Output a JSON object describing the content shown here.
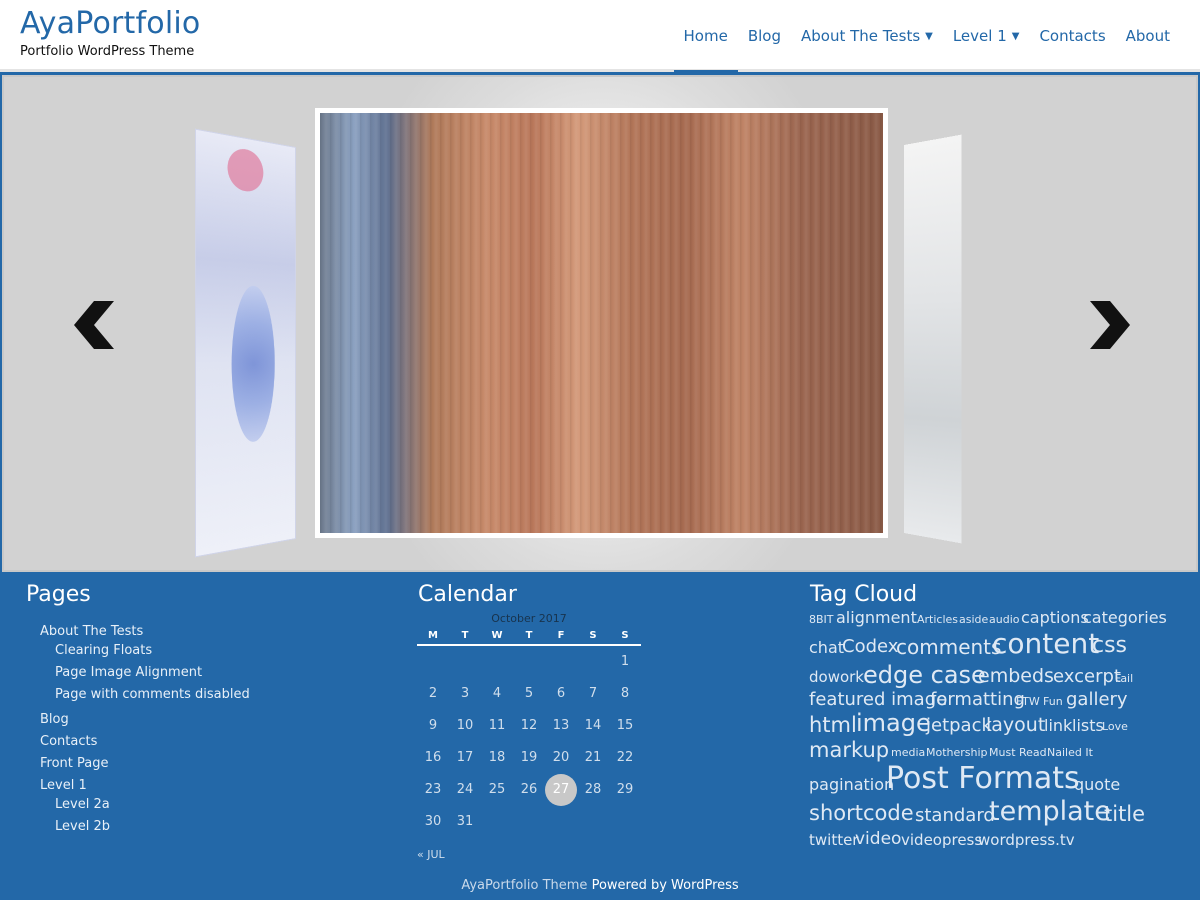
{
  "site": {
    "title": "AyaPortfolio",
    "description": "Portfolio WordPress Theme"
  },
  "nav": {
    "items": [
      {
        "label": "Home"
      },
      {
        "label": "Blog"
      },
      {
        "label": "About The Tests"
      },
      {
        "label": "Level 1"
      },
      {
        "label": "Contacts"
      },
      {
        "label": "About"
      }
    ],
    "active": "Home"
  },
  "pages": {
    "title": "Pages",
    "items": [
      "About The Tests",
      "Clearing Floats",
      "Page Image Alignment",
      "Page with comments disabled",
      "Blog",
      "Contacts",
      "Front Page",
      "Level 1",
      "Level 2a",
      "Level 2b"
    ]
  },
  "calendar": {
    "title": "Calendar",
    "caption": "October 2017",
    "weekdays": [
      "M",
      "T",
      "W",
      "T",
      "F",
      "S",
      "S"
    ],
    "rows": [
      [
        "",
        "",
        "",
        "",
        "",
        "",
        "1"
      ],
      [
        "2",
        "3",
        "4",
        "5",
        "6",
        "7",
        "8"
      ],
      [
        "9",
        "10",
        "11",
        "12",
        "13",
        "14",
        "15"
      ],
      [
        "16",
        "17",
        "18",
        "19",
        "20",
        "21",
        "22"
      ],
      [
        "23",
        "24",
        "25",
        "26",
        "27",
        "28",
        "29"
      ],
      [
        "30",
        "31",
        "",
        "",
        "",
        "",
        ""
      ]
    ],
    "today": "27",
    "prev": "« JUL"
  },
  "tagcloud": {
    "title": "Tag Cloud",
    "tags": [
      "8BIT",
      "alignment",
      "Articles",
      "aside",
      "audio",
      "captions",
      "categories",
      "chat",
      "Codex",
      "comments",
      "content",
      "css",
      "dowork",
      "edge case",
      "embeds",
      "excerpt",
      "Fail",
      "featured image",
      "formatting",
      "FTW",
      "Fun",
      "gallery",
      "html",
      "image",
      "jetpack",
      "layout",
      "link",
      "lists",
      "Love",
      "markup",
      "media",
      "Mothership",
      "Must Read",
      "Nailed It",
      "pagination",
      "Post Formats",
      "quote",
      "shortcode",
      "standard",
      "template",
      "title",
      "twitter",
      "video",
      "videopress",
      "wordpress.tv"
    ]
  },
  "footer": {
    "theme": "AyaPortfolio Theme",
    "powered": "Powered by WordPress"
  },
  "colors": {
    "brand": "#2368a8",
    "today_bg": "#c8c8c8"
  },
  "icons": {
    "prev": "chevron-left-icon",
    "next": "chevron-right-icon",
    "caret": "caret-down-icon"
  }
}
